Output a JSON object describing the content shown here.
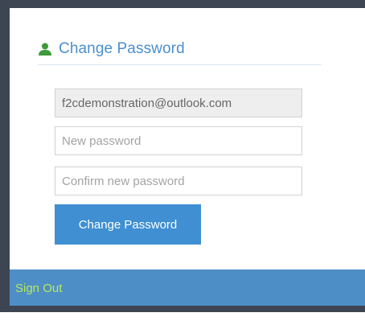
{
  "change_password": {
    "title": "Change Password",
    "email_value": "f2cdemonstration@outlook.com",
    "new_password_placeholder": "New password",
    "confirm_password_placeholder": "Confirm new password",
    "submit_label": "Change Password"
  },
  "footer": {
    "sign_out_label": "Sign Out"
  },
  "icons": {
    "title_icon": "user-icon"
  },
  "colors": {
    "accent": "#4a8fd0",
    "button": "#3f8fd2",
    "footer_bar": "#4e8ec6",
    "sign_out_text": "#b6e85a",
    "user_icon": "#3e9a3a",
    "frame": "#3d4452"
  }
}
